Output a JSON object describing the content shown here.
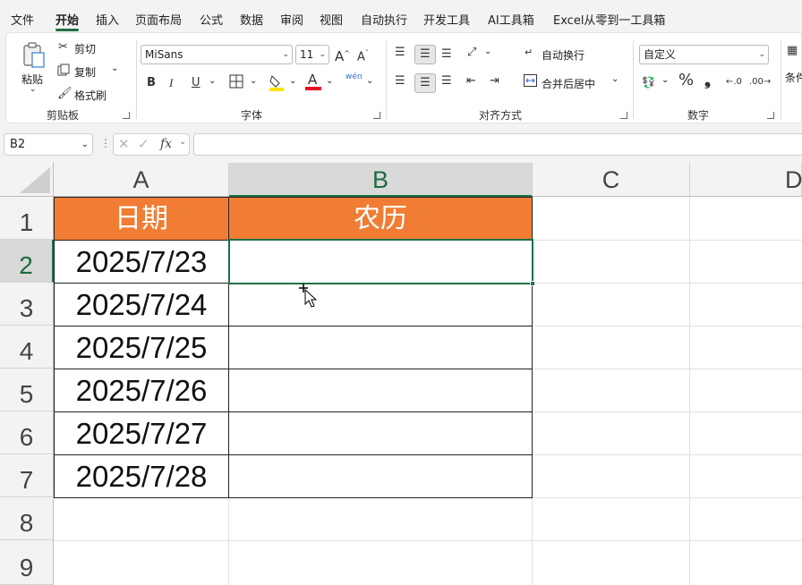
{
  "menu": {
    "tabs": [
      "文件",
      "开始",
      "插入",
      "页面布局",
      "公式",
      "数据",
      "审阅",
      "视图",
      "自动执行",
      "开发工具",
      "AI工具箱",
      "Excel从零到一工具箱"
    ],
    "active": "开始"
  },
  "ribbon": {
    "clipboard": {
      "paste": "粘贴",
      "cut": "剪切",
      "copy": "复制",
      "format_painter": "格式刷",
      "label": "剪贴板"
    },
    "font": {
      "name": "MiSans",
      "size": "11",
      "bold": "B",
      "italic": "I",
      "underline": "U",
      "label": "字体",
      "phonetic": "wén",
      "font_color": "A"
    },
    "alignment": {
      "wrap_text": "自动换行",
      "merge_center": "合并后居中",
      "label": "对齐方式"
    },
    "number": {
      "format": "自定义",
      "percent": "%",
      "comma": "❟",
      "label": "数字"
    },
    "styles": {
      "partial": "条件"
    }
  },
  "formula_bar": {
    "name_box": "B2",
    "fx": "fx",
    "formula": ""
  },
  "sheet": {
    "columns": [
      "A",
      "B",
      "C",
      "D"
    ],
    "selected_column": "B",
    "rows": [
      "1",
      "2",
      "3",
      "4",
      "5",
      "6",
      "7",
      "8",
      "9"
    ],
    "selected_row": "2",
    "header": {
      "a": "日期",
      "b": "农历"
    },
    "data": [
      {
        "date": "2025/7/23",
        "lunar": ""
      },
      {
        "date": "2025/7/24",
        "lunar": ""
      },
      {
        "date": "2025/7/25",
        "lunar": ""
      },
      {
        "date": "2025/7/26",
        "lunar": ""
      },
      {
        "date": "2025/7/27",
        "lunar": ""
      },
      {
        "date": "2025/7/28",
        "lunar": ""
      }
    ],
    "header_fill": "#F07D33",
    "accent": "#1E7145"
  }
}
